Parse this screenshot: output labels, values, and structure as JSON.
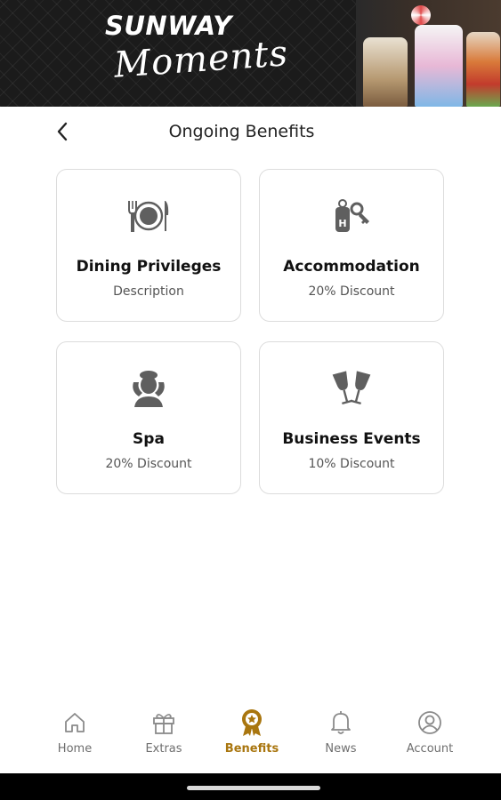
{
  "header": {
    "brand_line1": "SUNWAY",
    "brand_line2": "Moments"
  },
  "title_bar": {
    "back_icon": "chevron-left-icon",
    "title": "Ongoing Benefits"
  },
  "benefits": [
    {
      "icon": "dining-icon",
      "title": "Dining Privileges",
      "subtitle": "Description"
    },
    {
      "icon": "hotel-key-icon",
      "title": "Accommodation",
      "subtitle": "20% Discount"
    },
    {
      "icon": "spa-icon",
      "title": "Spa",
      "subtitle": "20% Discount"
    },
    {
      "icon": "toast-glasses-icon",
      "title": "Business Events",
      "subtitle": "10% Discount"
    }
  ],
  "nav": {
    "active": "Benefits",
    "items": [
      {
        "icon": "home-icon",
        "label": "Home"
      },
      {
        "icon": "gift-icon",
        "label": "Extras"
      },
      {
        "icon": "award-badge-icon",
        "label": "Benefits"
      },
      {
        "icon": "bell-icon",
        "label": "News"
      },
      {
        "icon": "account-icon",
        "label": "Account"
      }
    ]
  },
  "colors": {
    "accent": "#a9760f",
    "icon_gray": "#5f5f5f",
    "nav_gray": "#6e6e6e",
    "card_border": "#dcdcdc",
    "banner_bg": "#1b1b1b"
  }
}
